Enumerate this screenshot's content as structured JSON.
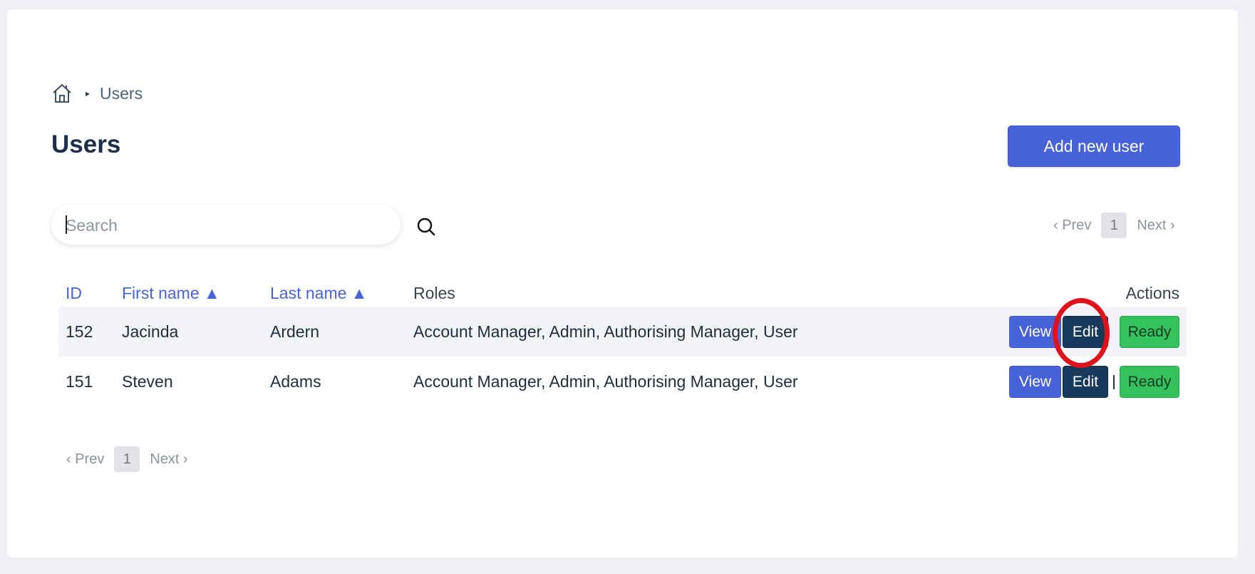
{
  "breadcrumb": {
    "home_icon": "home-icon",
    "separator": "▸",
    "current": "Users"
  },
  "page": {
    "title": "Users",
    "add_button": "Add new user"
  },
  "search": {
    "placeholder": "Search",
    "icon": "search-icon"
  },
  "pagination": {
    "prev": "‹ Prev",
    "current_page": "1",
    "next": "Next ›"
  },
  "table": {
    "headers": {
      "id": "ID",
      "first_name": "First name ▲",
      "last_name": "Last name ▲",
      "roles": "Roles",
      "actions": "Actions"
    },
    "rows": [
      {
        "id": "152",
        "first_name": "Jacinda",
        "last_name": "Ardern",
        "roles": "Account Manager, Admin, Authorising Manager, User"
      },
      {
        "id": "151",
        "first_name": "Steven",
        "last_name": "Adams",
        "roles": "Account Manager, Admin, Authorising Manager, User"
      }
    ],
    "action_labels": {
      "view": "View",
      "edit": "Edit",
      "ready": "Ready"
    }
  },
  "colors": {
    "primary": "#4863d9",
    "dark": "#173a5c",
    "success": "#35c25d",
    "highlight": "#e0121c"
  }
}
